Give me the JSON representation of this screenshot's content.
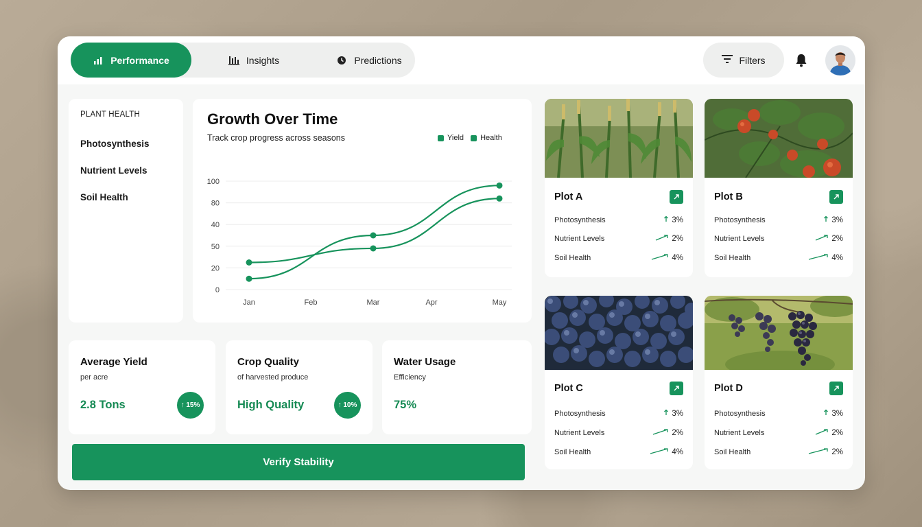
{
  "tabs": [
    {
      "label": "Performance",
      "icon": "bar-chart-icon",
      "active": true
    },
    {
      "label": "Insights",
      "icon": "columns-chart-icon",
      "active": false
    },
    {
      "label": "Predictions",
      "icon": "clock-icon",
      "active": false
    }
  ],
  "header": {
    "filters_label": "Filters"
  },
  "sidebar": {
    "heading": "PLANT HEALTH",
    "items": [
      {
        "label": "Photosynthesis"
      },
      {
        "label": "Nutrient Levels"
      },
      {
        "label": "Soil Health"
      }
    ]
  },
  "chart_data": {
    "type": "line",
    "title": "Growth Over Time",
    "subtitle": "Track crop progress across seasons",
    "categories": [
      "Jan",
      "Feb",
      "Mar",
      "Apr",
      "May"
    ],
    "y_ticks": [
      "0",
      "20",
      "50",
      "40",
      "80",
      "100"
    ],
    "legend": [
      "Yield",
      "Health"
    ],
    "legend_position": "top-right",
    "grid": true,
    "series": [
      {
        "name": "Yield",
        "marker_x": [
          "Jan",
          "Mar",
          "May"
        ],
        "values": [
          10,
          50,
          96
        ]
      },
      {
        "name": "Health",
        "marker_x": [
          "Jan",
          "Mar",
          "May"
        ],
        "values": [
          25,
          38,
          84
        ]
      }
    ],
    "color": "#17935c"
  },
  "stats": [
    {
      "title": "Average Yield",
      "subtitle": "per acre",
      "value": "2.8 Tons",
      "badge": "↑ 15%"
    },
    {
      "title": "Crop Quality",
      "subtitle": "of harvested produce",
      "value": "High Quality",
      "badge": "↑ 10%"
    },
    {
      "title": "Water Usage",
      "subtitle": "Efficiency",
      "value": "75%",
      "badge": ""
    }
  ],
  "verify_label": "Verify Stability",
  "plots": [
    {
      "name": "Plot A",
      "image": "corn-field",
      "metrics": [
        {
          "label": "Photosynthesis",
          "value": "3%",
          "arrow": "up"
        },
        {
          "label": "Nutrient Levels",
          "value": "2%",
          "arrow": "trend"
        },
        {
          "label": "Soil Health",
          "value": "4%",
          "arrow": "trend"
        }
      ]
    },
    {
      "name": "Plot B",
      "image": "tomato-plant",
      "metrics": [
        {
          "label": "Photosynthesis",
          "value": "3%",
          "arrow": "up"
        },
        {
          "label": "Nutrient Levels",
          "value": "2%",
          "arrow": "trend"
        },
        {
          "label": "Soil Health",
          "value": "4%",
          "arrow": "trend"
        }
      ]
    },
    {
      "name": "Plot C",
      "image": "blueberries",
      "metrics": [
        {
          "label": "Photosynthesis",
          "value": "3%",
          "arrow": "up"
        },
        {
          "label": "Nutrient Levels",
          "value": "2%",
          "arrow": "trend"
        },
        {
          "label": "Soil Health",
          "value": "4%",
          "arrow": "trend"
        }
      ]
    },
    {
      "name": "Plot D",
      "image": "grapes",
      "metrics": [
        {
          "label": "Photosynthesis",
          "value": "3%",
          "arrow": "up"
        },
        {
          "label": "Nutrient Levels",
          "value": "2%",
          "arrow": "trend"
        },
        {
          "label": "Soil Health",
          "value": "2%",
          "arrow": "trend"
        }
      ]
    }
  ]
}
